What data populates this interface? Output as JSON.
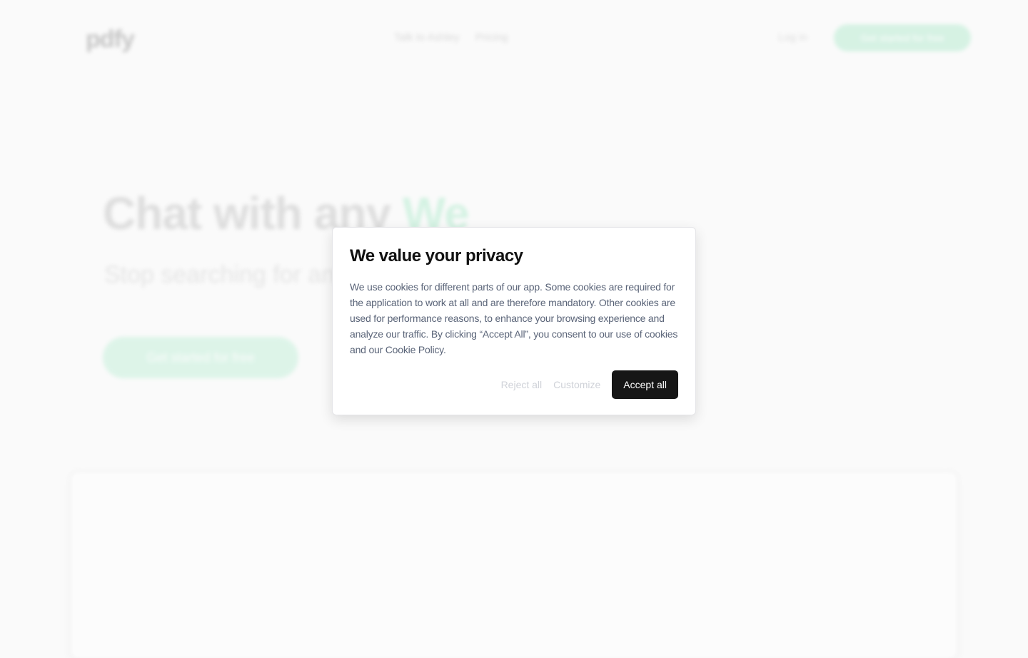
{
  "background": {
    "logo": "pdfy",
    "nav_links": [
      "Talk to Ashley",
      "Pricing"
    ],
    "login": "Log in",
    "nav_cta": "Get started for free",
    "hero_title_main": "Chat with any ",
    "hero_title_accent": "We",
    "hero_subtitle": "Stop searching for an",
    "hero_cta": "Get started for free",
    "accent_color": "#b5ecd0"
  },
  "cookie_modal": {
    "title": "We value your privacy",
    "body": "We use cookies for different parts of our app. Some cookies are required for the application to work at all and are therefore mandatory. Other cookies are used for performance reasons, to enhance your browsing experience and analyze our traffic. By clicking “Accept All”, you consent to our use of cookies and our Cookie Policy.",
    "reject_label": "Reject all",
    "customize_label": "Customize",
    "accept_label": "Accept all"
  }
}
